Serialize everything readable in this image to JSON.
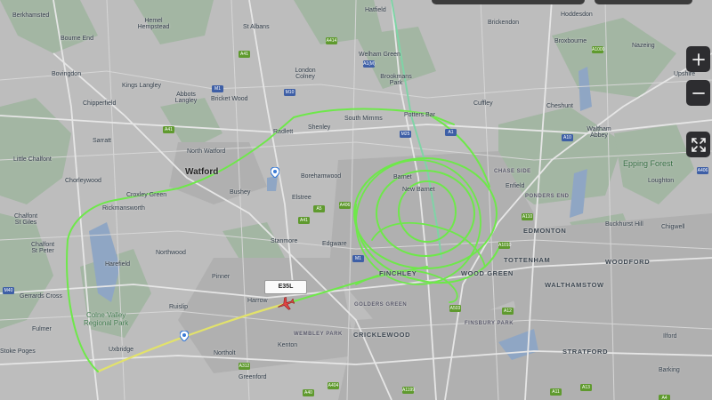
{
  "map": {
    "towns": {
      "berkhamsted": "Berkhamsted",
      "hatfield": "Hatfield",
      "hoddesdon": "Hoddesdon",
      "hemel": "Hemel Hempstead",
      "st_albans": "St Albans",
      "bourne_end": "Bourne End",
      "bovingdon": "Bovingdon",
      "kings_langley": "Kings Langley",
      "abbots_langley": "Abbots Langley",
      "bricket_wood": "Bricket Wood",
      "london_colney": "London Colney",
      "welham_green": "Welham Green",
      "brookmans_park": "Brookmans Park",
      "brickendon": "Brickendon",
      "broxbourne": "Broxbourne",
      "nazeing": "Nazeing",
      "chipperfield": "Chipperfield",
      "cuffley": "Cuffley",
      "cheshunt": "Cheshunt",
      "upshire": "Upshire",
      "sarratt": "Sarratt",
      "radlett": "Radlett",
      "shenley": "Shenley",
      "south_mimms": "South Mimms",
      "potters_bar": "Potters Bar",
      "waltham_abbey": "Waltham Abbey",
      "north_watford": "North Watford",
      "little_chalfont": "Little Chalfont",
      "watford": "Watford",
      "borehamwood": "Borehamwood",
      "barnet": "Barnet",
      "chase_side": "CHASE SIDE",
      "enfield": "Enfield",
      "epping_forest": "Epping Forest",
      "loughton": "Loughton",
      "chorleywood": "Chorleywood",
      "croxley_green": "Croxley Green",
      "bushey": "Bushey",
      "elstree": "Elstree",
      "new_barnet": "New Barnet",
      "ponders_end": "PONDERS END",
      "chalfont_st_giles": "Chalfont\nSt Giles",
      "rickmansworth": "Rickmansworth",
      "edmonton": "EDMONTON",
      "buckhurst_hill": "Buckhurst Hill",
      "chigwell": "Chigwell",
      "stanmore": "Stanmore",
      "edgware": "Edgware",
      "chalfont_st_peter": "Chalfont\nSt Peter",
      "northwood": "Northwood",
      "tottenham": "TOTTENHAM",
      "woodford": "WOODFORD",
      "harefield": "Harefield",
      "finchley": "FINCHLEY",
      "wood_green": "WOOD GREEN",
      "walthamstow": "WALTHAMSTOW",
      "gerrards_cross": "Gerrards Cross",
      "pinner": "Pinner",
      "harrow": "Harrow",
      "colne_valley": "Colne Valley\nRegional Park",
      "ruislip": "Ruislip",
      "golders_green": "GOLDERS GREEN",
      "finsbury_park": "FINSBURY PARK",
      "fulmer": "Fulmer",
      "wembley_park": "WEMBLEY PARK",
      "cricklewood": "CRICKLEWOOD",
      "ilford": "Ilford",
      "stoke_poges": "Stoke Poges",
      "uxbridge": "Uxbridge",
      "northolt": "Northolt",
      "kenton": "Kenton",
      "stratford": "STRATFORD",
      "barking": "Barking",
      "greenford": "Greenford"
    },
    "roads": {
      "a41": "A41",
      "a414": "A414",
      "a1m": "A1(M)",
      "a1000": "A1000",
      "m1": "M1",
      "m10": "M10",
      "m25": "M25",
      "a1": "A1",
      "a10": "A10",
      "a406": "A406",
      "a40": "A40",
      "m40": "M40",
      "a4": "A4",
      "a13": "A13",
      "a12": "A12",
      "a41b": "A41",
      "a5": "A5",
      "a406b": "A406",
      "a404": "A404",
      "a312": "A312",
      "a1010": "A1010",
      "a110": "A110",
      "a503": "A503",
      "a11": "A11",
      "a1199": "A1199"
    },
    "flight": {
      "callsign": "E35L",
      "colors": {
        "track_green": "#6ee84a",
        "track_yellow": "#e8e860",
        "aircraft": "#e04444"
      }
    },
    "controls": {
      "zoom_in": "+",
      "zoom_out": "−"
    },
    "icons": [
      "plus-icon",
      "minus-icon",
      "fullscreen-icon",
      "location-pin-icon",
      "aircraft-icon"
    ]
  }
}
